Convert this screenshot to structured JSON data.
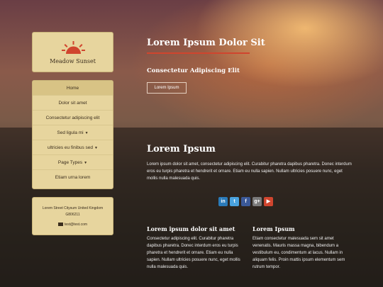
{
  "brand": {
    "name": "Meadow Sunset",
    "logo_icon": "sun-icon",
    "accent": "#d0452e"
  },
  "nav": {
    "items": [
      {
        "label": "Home",
        "active": true
      },
      {
        "label": "Dolor sit amet"
      },
      {
        "label": "Consectetur adipiscing elit"
      },
      {
        "label": "Sed ligula mi",
        "dropdown": true
      },
      {
        "label": "ultricies eu finibus sed",
        "dropdown": true
      },
      {
        "label": "Page Types",
        "dropdown": true
      },
      {
        "label": "Etiam urna lorem"
      }
    ],
    "caret": "▼"
  },
  "contact": {
    "address": "Lorem Street Citysum United Kingdom G806211",
    "email": "test@test.com",
    "email_icon": "envelope-icon"
  },
  "hero": {
    "title": "Lorem Ipsum Dolor Sit",
    "subtitle": "Consectetur Adipiscing Elit",
    "button": "Lorem Ipsum"
  },
  "section": {
    "title": "Lorem Ipsum",
    "text": "Lorem ipsum dolor sit amet, consectetur adipiscing elit. Curabitur pharetra dapibus pharetra. Donec interdum eros eu turpis pharetra et hendrerit et ornare. Etiam eu nulla sapien. Nullam ultricies posuere nunc, eget mollis nulla malesuada quis."
  },
  "social": [
    {
      "label": "in",
      "icon": "linkedin-icon",
      "color": "#2b7bb9"
    },
    {
      "label": "t",
      "icon": "twitter-icon",
      "color": "#4aa3df"
    },
    {
      "label": "f",
      "icon": "facebook-icon",
      "color": "#3b5998"
    },
    {
      "label": "g+",
      "icon": "googleplus-icon",
      "color": "#7a7a7a"
    },
    {
      "label": "▶",
      "icon": "youtube-icon",
      "color": "#d0452e"
    }
  ],
  "columns": [
    {
      "title": "Lorem ipsum dolor sit amet",
      "text": "Consectetur adipiscing elit. Curabitur pharetra dapibus pharetra. Donec interdum eros eu turpis pharetra et hendrerit et ornare. Etiam eu nulla sapien. Nullam ultricies posuere nunc, eget mollis nulla malesuada quis."
    },
    {
      "title": "Lorem Ipsum",
      "text": "Etiam consectetur malesuada sem sit amet venenatis. Mauris massa magna, bibendum a vestibulum eu, condimentum at lacus. Nullam in aliquam felis. Proin mattis ipsum elementum sem rutrum tempor."
    }
  ]
}
